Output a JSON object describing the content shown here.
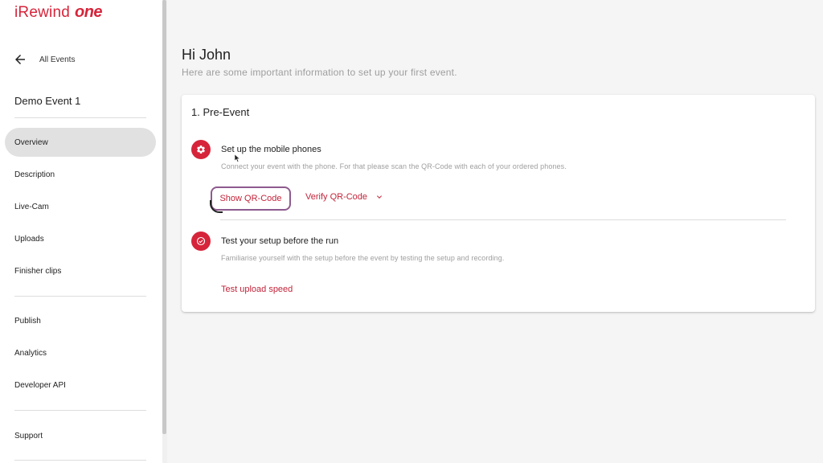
{
  "app": {
    "brand_name": "iRewind",
    "brand_suffix": "one",
    "brand_color": "#d6243a"
  },
  "sidebar": {
    "back_label": "All Events",
    "event_title": "Demo Event 1",
    "items": [
      {
        "label": "Overview",
        "active": true
      },
      {
        "label": "Description"
      },
      {
        "label": "Live-Cam"
      },
      {
        "label": "Uploads"
      },
      {
        "label": "Finisher clips"
      },
      {
        "label": "Publish"
      },
      {
        "label": "Analytics"
      },
      {
        "label": "Developer API"
      },
      {
        "label": "Support"
      }
    ]
  },
  "main": {
    "greeting": "Hi John",
    "subtitle": "Here are some important information to set up your first event.",
    "card": {
      "title": "1. Pre-Event",
      "steps": [
        {
          "icon": "gear-icon",
          "title": "Set up the mobile phones",
          "description": "Connect your event with the phone. For that please scan the QR-Code with each of your ordered phones.",
          "actions": [
            "Show QR-Code",
            "Verify QR-Code"
          ]
        },
        {
          "icon": "check-circle-icon",
          "title": "Test your setup before the run",
          "description": "Familiarise yourself with the setup before the event by testing the setup and recording.",
          "actions": [
            "Test upload speed"
          ]
        }
      ]
    }
  }
}
